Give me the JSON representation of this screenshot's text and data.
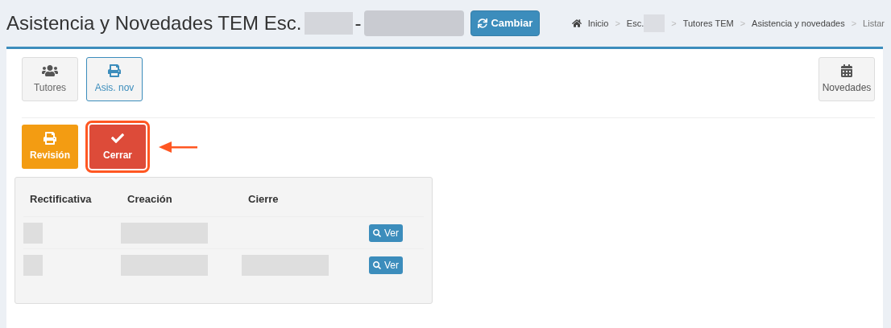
{
  "header": {
    "title": "Asistencia y Novedades TEM Esc.",
    "separator": "-",
    "change_button": "Cambiar"
  },
  "breadcrumb": {
    "separator": ">",
    "items": [
      {
        "label": "Inicio",
        "kind": "home"
      },
      {
        "label": "Esc.",
        "kind": "redacted"
      },
      {
        "label": "Tutores TEM",
        "kind": "plain"
      },
      {
        "label": "Asistencia y novedades",
        "kind": "plain"
      },
      {
        "label": "Listar",
        "kind": "current"
      }
    ]
  },
  "tabs": [
    {
      "label": "Tutores",
      "selected": false
    },
    {
      "label": "Asis. nov",
      "selected": true
    }
  ],
  "right_tab": {
    "label": "Novedades"
  },
  "actions": [
    {
      "label": "Revisión",
      "color": "#f39c12",
      "highlighted": false
    },
    {
      "label": "Cerrar",
      "color": "#dd4b39",
      "highlighted": true
    }
  ],
  "table": {
    "columns": [
      "Rectificativa",
      "Creación",
      "Cierre"
    ],
    "rows": [
      {
        "redacted": [
          true,
          true,
          false
        ],
        "button": "Ver"
      },
      {
        "redacted": [
          true,
          true,
          true
        ],
        "button": "Ver"
      }
    ]
  }
}
